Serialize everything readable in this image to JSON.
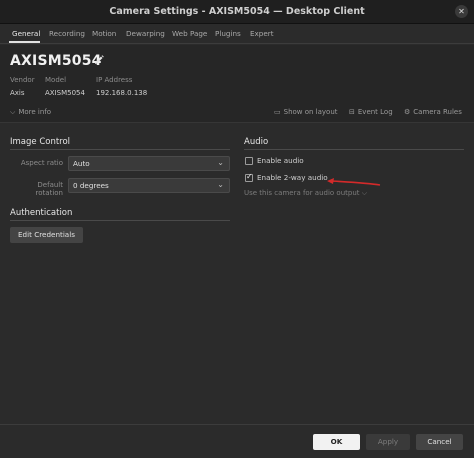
{
  "window": {
    "title": "Camera Settings - AXISM5054 — Desktop Client"
  },
  "tabs": [
    "General",
    "Recording",
    "Motion",
    "Dewarping",
    "Web Page",
    "Plugins",
    "Expert"
  ],
  "header": {
    "camera_name": "AXISM5054",
    "vendor_label": "Vendor",
    "vendor_value": "Axis",
    "model_label": "Model",
    "model_value": "AXISM5054",
    "ip_label": "IP Address",
    "ip_value": "192.168.0.138",
    "more_info": "More info",
    "show_on_layout": "Show on layout",
    "event_log": "Event Log",
    "camera_rules": "Camera Rules"
  },
  "image_control": {
    "title": "Image Control",
    "aspect_ratio_label": "Aspect ratio",
    "aspect_ratio_value": "Auto",
    "rotation_label": "Default rotation",
    "rotation_value": "0 degrees"
  },
  "authentication": {
    "title": "Authentication",
    "edit_credentials": "Edit Credentials"
  },
  "audio": {
    "title": "Audio",
    "enable_audio": "Enable audio",
    "enable_audio_checked": false,
    "enable_2way": "Enable 2-way audio",
    "enable_2way_checked": true,
    "audio_output": "Use this camera for audio output"
  },
  "footer": {
    "ok": "OK",
    "apply": "Apply",
    "cancel": "Cancel"
  },
  "colors": {
    "annotation_arrow": "#d42a2a",
    "background": "#2b2b2b"
  }
}
